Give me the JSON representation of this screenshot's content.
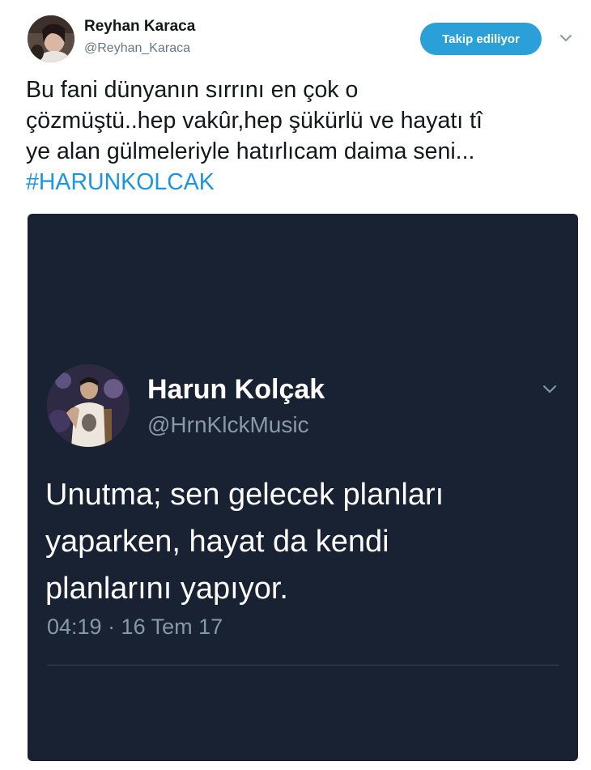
{
  "tweet": {
    "author": {
      "name": "Reyhan Karaca",
      "handle": "@Reyhan_Karaca"
    },
    "follow_label": "Takip ediliyor",
    "text_lines": [
      "Bu fani dünyanın sırrını en çok o",
      "çözmüştü..hep vakûr,hep şükürlü ve hayatı tî",
      "ye alan gülmeleriyle hatırlıcam daima seni..."
    ],
    "hashtag": "#HARUNKOLCAK"
  },
  "embedded_screenshot": {
    "author": {
      "name": "Harun Kolçak",
      "handle": "@HrnKlckMusic"
    },
    "text_lines": [
      "Unutma; sen gelecek planları",
      "yaparken, hayat da kendi",
      "planlarını yapıyor."
    ],
    "timestamp": "04:19 · 16 Tem 17"
  },
  "colors": {
    "accent": "#1b95e0",
    "follow_button": "#2a9fd8",
    "dark_background": "#182233",
    "muted_text": "#8899a6"
  },
  "icons": {
    "header_menu": "chevron-down-icon",
    "embedded_menu": "chevron-down-icon"
  }
}
